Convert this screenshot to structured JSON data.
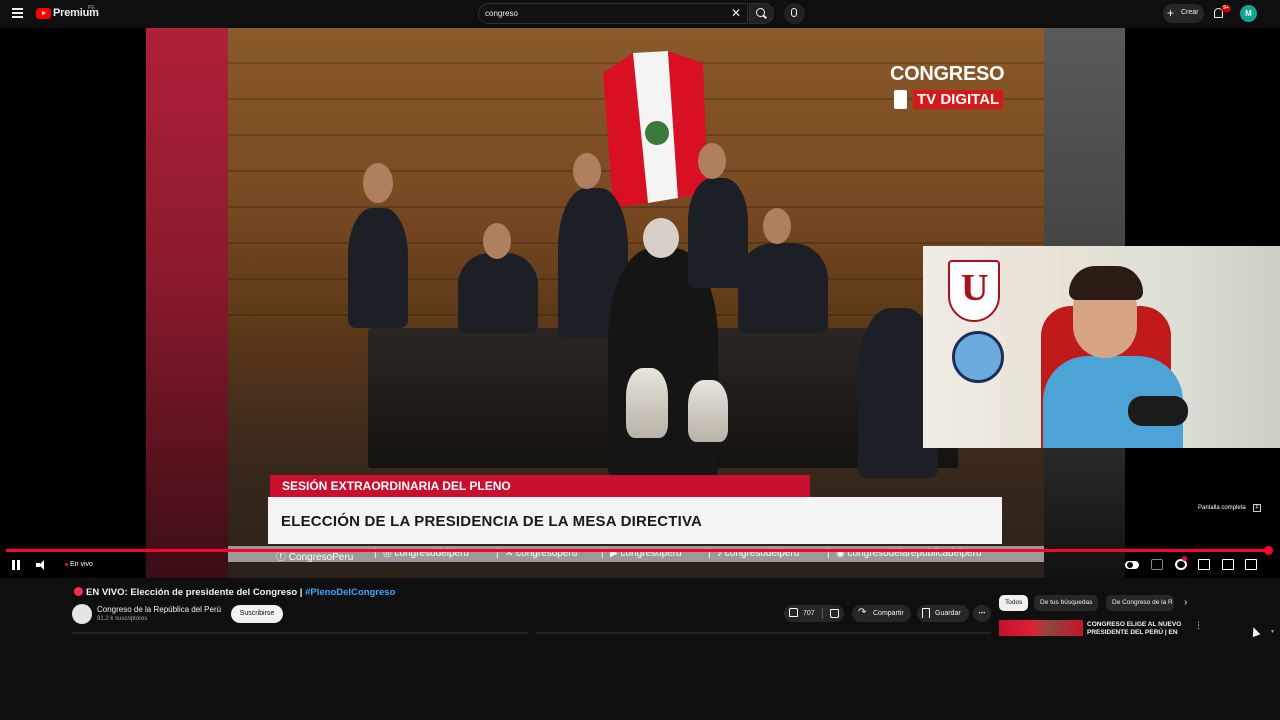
{
  "header": {
    "logo_text": "Premium",
    "logo_sup": "PE",
    "search_value": "congreso",
    "create_label": "Crear",
    "notifications_badge": "9+",
    "avatar_letter": "M"
  },
  "player": {
    "brand_title": "CONGRESO",
    "brand_sub": "TV DIGITAL",
    "lower_third_tag": "SESIÓN EXTRAORDINARIA DEL PLENO",
    "lower_third_title": "ELECCIÓN DE LA PRESIDENCIA DE LA MESA DIRECTIVA",
    "social": [
      "CongresoPeru",
      "congresodelperu",
      "congresoperu",
      "congresoperu",
      "congresodelperu",
      "congresodelarepublicadelperu"
    ],
    "fullscreen_tip": "Pantalla completa",
    "fullscreen_key": "F",
    "live_label": "En vivo",
    "progress": 1.0
  },
  "video": {
    "title": "EN VIVO: Elección de presidente del Congreso | ",
    "hashtag": "#PlenoDelCongreso",
    "channel_name": "Congreso de la República del Perú",
    "subscribers": "91.2 k suscriptores",
    "subscribe_label": "Suscribirse",
    "like_count": "707",
    "share_label": "Compartir",
    "save_label": "Guardar",
    "more_label": "⋯"
  },
  "recommendations": {
    "chips": [
      "Todos",
      "De tus búsquedas",
      "De Congreso de la R"
    ],
    "first_title": "CONGRESO ELIGE AL NUEVO PRESIDENTE DEL PERÚ | EN"
  },
  "colors": {
    "accent": "#ff0033",
    "congreso_red": "#c8102e",
    "link_blue": "#3ea6ff"
  }
}
